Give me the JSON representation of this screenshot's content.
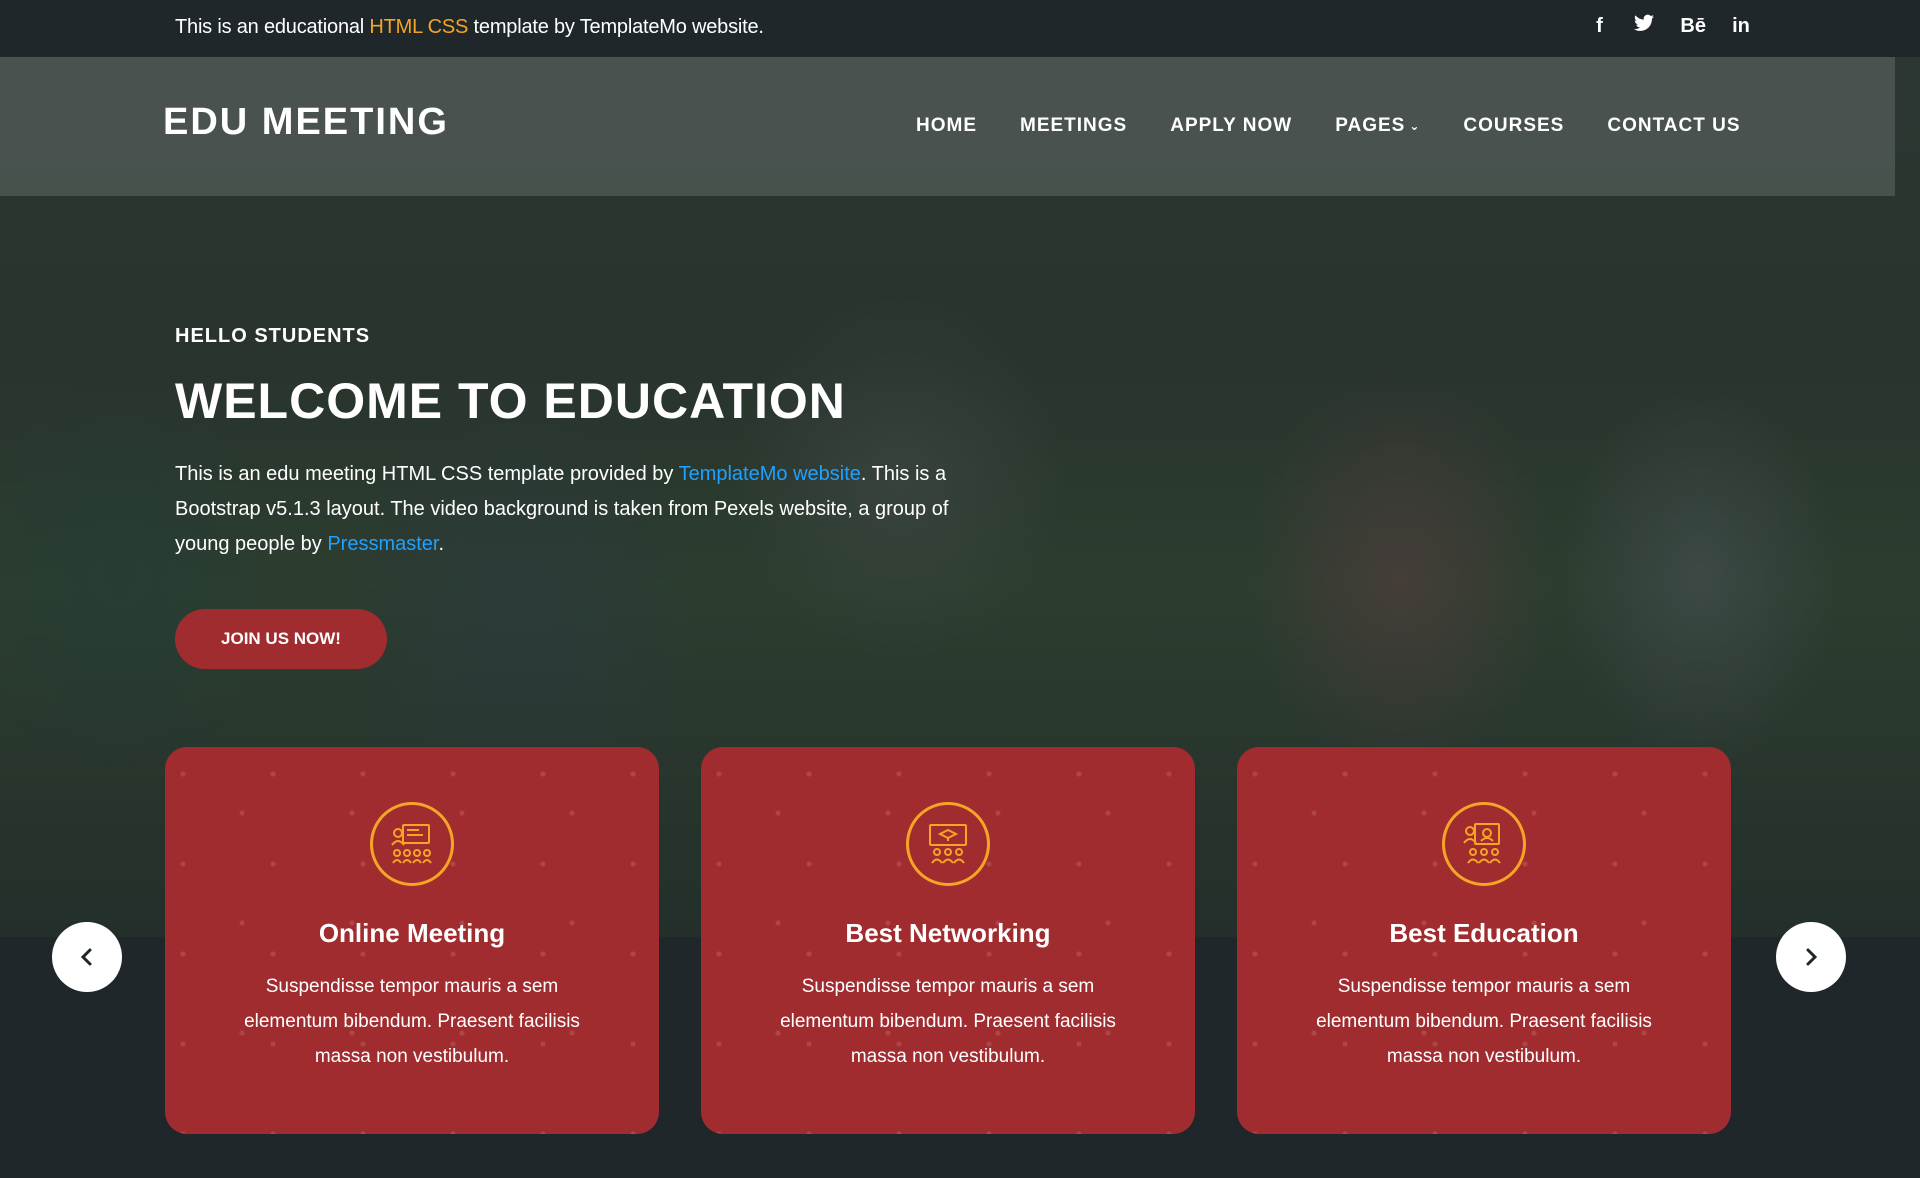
{
  "topbar": {
    "message_pre": "This is an educational ",
    "message_hl": "HTML CSS",
    "message_post": " template by TemplateMo website.",
    "social": [
      {
        "icon": "facebook-icon",
        "glyph": "f"
      },
      {
        "icon": "twitter-icon",
        "glyph": "🐦"
      },
      {
        "icon": "behance-icon",
        "glyph": "Bē"
      },
      {
        "icon": "linkedin-icon",
        "glyph": "in"
      }
    ]
  },
  "header": {
    "logo": "EDU MEETING",
    "nav": [
      {
        "label": "HOME"
      },
      {
        "label": "MEETINGS"
      },
      {
        "label": "APPLY NOW"
      },
      {
        "label": "PAGES"
      },
      {
        "label": "COURSES"
      },
      {
        "label": "CONTACT US"
      }
    ]
  },
  "hero": {
    "kicker": "HELLO STUDENTS",
    "title": "WELCOME TO EDUCATION",
    "text_1": "This is an edu meeting HTML CSS template provided by ",
    "link_1": "TemplateMo website",
    "text_2": ". This is a Bootstrap v5.1.3 layout. The video background is taken from Pexels website, a group of young people by ",
    "link_2": "Pressmaster",
    "text_3": ".",
    "button": "JOIN US NOW!"
  },
  "cards": [
    {
      "title": "Online Meeting",
      "text": "Suspendisse tempor mauris a sem elementum bibendum. Praesent facilisis massa non vestibulum.",
      "icon": "online-meeting-icon"
    },
    {
      "title": "Best Networking",
      "text": "Suspendisse tempor mauris a sem elementum bibendum. Praesent facilisis massa non vestibulum.",
      "icon": "networking-icon"
    },
    {
      "title": "Best Education",
      "text": "Suspendisse tempor mauris a sem elementum bibendum. Praesent facilisis massa non vestibulum.",
      "icon": "education-icon"
    }
  ],
  "colors": {
    "accent_red": "#a12c2f",
    "accent_orange": "#f5a425",
    "link_blue": "#1fa1ff",
    "dark_bg": "#1f272b"
  }
}
